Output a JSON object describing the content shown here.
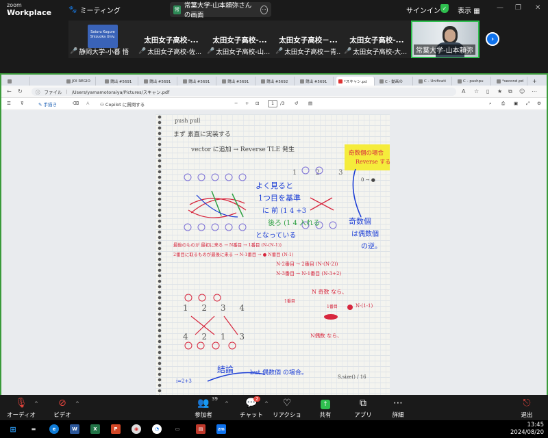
{
  "zoom": {
    "logo_line1": "zoom",
    "logo_line2": "Workplace",
    "meeting_label": "ミーティング",
    "share_badge": "常",
    "share_label": "常葉大学-山本頼弥さんの画面",
    "signin_label": "サインイン",
    "view_label": "表示"
  },
  "gallery": {
    "tiles": [
      {
        "name": "",
        "caption": "静岡大学-小暮 悟",
        "thumb_line1": "Satoru Kogure",
        "thumb_line2": "Shizuoka Univ."
      },
      {
        "name": "太田女子高校-...",
        "caption": "太田女子高校-佐..."
      },
      {
        "name": "太田女子高校-...",
        "caption": "太田女子高校-山..."
      },
      {
        "name": "太田女子高校－...",
        "caption": "太田女子高校ー青..."
      },
      {
        "name": "太田女子高校-...",
        "caption": "太田女子高校-大..."
      },
      {
        "name": "",
        "caption": "常葉大学-山本頼弥"
      }
    ]
  },
  "browser": {
    "tabs": [
      "JOI REGIO",
      "競出 #5691",
      "競出 #5691",
      "競出 #5691",
      "競出 #5691",
      "競出 #5692",
      "競出 #5691",
      "*スキャン.pd",
      "C - 動画の",
      "C - Unificati",
      "C - pushpu",
      "*second.pd"
    ],
    "address_label": "ファイル",
    "address_path": "/Users/yamamotoraiya/Pictures/スキャン.pdf",
    "pdf_draw_label": "手描き",
    "pdf_copilot_label": "Copilot に質問する",
    "pdf_zoom_minus": "−",
    "pdf_zoom_plus": "+",
    "page_current": "1",
    "page_total": "/3"
  },
  "notes": {
    "title": "push pull",
    "line1": "まず 素直に実装する",
    "line2": "vector に追加 → Reverse  TLE 発生",
    "box_line1": "奇数個の場合",
    "box_line2": "Reverse する",
    "blue_note1": "よく見ると",
    "blue_note2": "1つ目を基準",
    "blue_note3": "に 前 (1 4 +3",
    "green_note": "後ろ (1 4 入れる",
    "blue_note4": "となっている",
    "blue_side1": "奇数個",
    "blue_side2": "は偶数個",
    "blue_side3": "の逆。",
    "red_line1": "最後のものが 最初に来る → N番目 → 1番目  (N-(N-1))",
    "red_line2": "2番目に取るものが最後に来る → N-1番目 → ● N番目  (N-1)",
    "red_line3": "N-2番目 → 2番目  (N-(N-2))",
    "red_line4": "N-3番目 → N-1番目  (N-3+2)",
    "red_n_odd": "N 奇数 なら、",
    "red_first": "1番目",
    "red_n_minus": "N-(1-1)",
    "red_index_small": "1番目",
    "red_n_even": "N偶数 なら、",
    "numbers_top": "1 2 3",
    "numbers_row": "1 2 3 4",
    "numbers_bottom": "4 2 1 3",
    "conclusion": "結論",
    "conclusion_sub": "but 偶数個 の場合。",
    "size_note": "S.size() / 16",
    "arrow_note": "0 → ●",
    "bottom_left": "i=2+3"
  },
  "controls": {
    "audio": "オーディオ",
    "video": "ビデオ",
    "participants": "参加者",
    "participants_count": "39",
    "chat": "チャット",
    "chat_count": "2",
    "reactions": "リアクション",
    "share": "共有",
    "apps": "アプリ",
    "more": "詳細",
    "leave": "退出"
  },
  "taskbar": {
    "time": "13:45",
    "date": "2024/08/20"
  },
  "colors": {
    "zoom_blue": "#0e72ed",
    "share_green": "#2fbf4f",
    "mute_red": "#e0433b",
    "ink_red": "#d7263d",
    "ink_blue": "#1d3fd6",
    "ink_green": "#2ea043",
    "highlight_yellow": "#f5ec3b"
  }
}
